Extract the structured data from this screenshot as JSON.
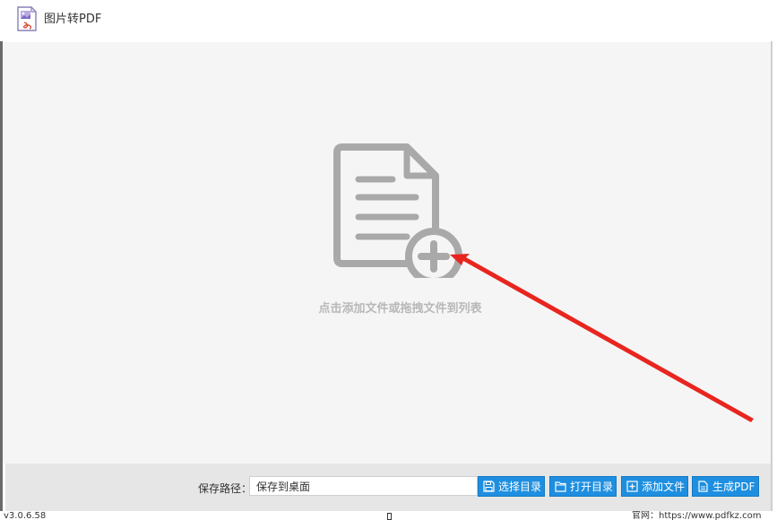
{
  "app": {
    "title": "图片转PDF"
  },
  "drop_zone": {
    "hint": "点击添加文件或拖拽文件到列表"
  },
  "bottom_bar": {
    "save_path_label": "保存路径：",
    "save_path_value": "保存到桌面",
    "buttons": {
      "choose_dir": "选择目录",
      "open_dir": "打开目录",
      "add_file": "添加文件",
      "generate_pdf": "生成PDF"
    }
  },
  "status_bar": {
    "version": "v3.0.6.58",
    "website": "官网：https://www.pdfkz.com"
  },
  "colors": {
    "accent": "#1e8fe0",
    "annotation_arrow": "#e8251f",
    "drop_icon": "#a9a9a9"
  }
}
